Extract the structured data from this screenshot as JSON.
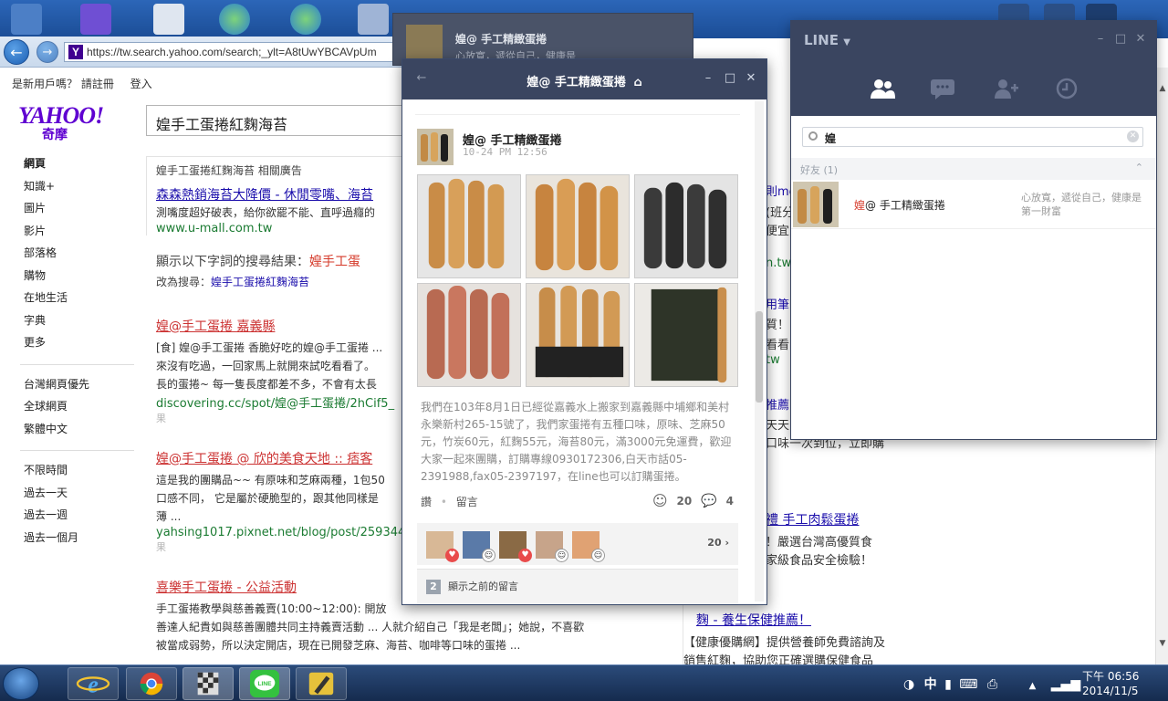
{
  "browser": {
    "url": "https://tw.search.yahoo.com/search;_ylt=A8tUwYBCAVpUm",
    "top_links": [
      "是新用戶嗎？ 請註冊",
      "登入"
    ],
    "logo_text": "YAHOO!",
    "logo_sub": "奇摩",
    "search_value": "媓手工蛋捲紅麴海苔"
  },
  "left_nav": {
    "group1": [
      "網頁",
      "知識+",
      "圖片",
      "影片",
      "部落格",
      "購物",
      "在地生活",
      "字典",
      "更多"
    ],
    "group2": [
      "台灣網頁優先",
      "全球網頁",
      "繁體中文"
    ],
    "group3": [
      "不限時間",
      "過去一天",
      "過去一週",
      "過去一個月"
    ]
  },
  "results": {
    "ad_header": "媓手工蛋捲紅麴海苔 相關廣告",
    "ad1_title": "森森熱銷海苔大降價 - 休閒零嘴、海苔",
    "ad1_text": "測嘴度超好破表，給你欲罷不能、直呼過癮的",
    "ad1_url": "www.u-mall.com.tw",
    "showing_label": "顯示以下字詞的搜尋結果：",
    "showing_term": "媓手工蛋",
    "instead_label": "改為搜尋：",
    "instead_term": "媓手工蛋捲紅麴海苔",
    "r1_title": "媓@手工蛋捲 嘉義縣",
    "r1_line1": "[食] 媓@手工蛋捲 香脆好吃的媓@手工蛋捲 ...",
    "r1_line2": "來沒有吃過，一回家馬上就開來試吃看看了。",
    "r1_line3": "長的蛋捲~ 每一隻長度都差不多，不會有太長",
    "r1_url": "discovering.cc/spot/媓@手工蛋捲/2hCif5_",
    "r1_small": "果",
    "r2_title": "媓@手工蛋捲 @ 欣的美食天地 :: 痞客",
    "r2_line1": "這是我的團購品~~ 有原味和芝麻兩種，1包50",
    "r2_line2": "口感不同， 它是屬於硬脆型的，跟其他同樣是",
    "r2_line3": "薄 ...",
    "r2_url": "yahsing1017.pixnet.net/blog/post/2593441",
    "r2_small": "果",
    "r3_title": "喜樂手工蛋捲 - 公益活動",
    "r3_line1": "手工蛋捲教學與慈善義賣(10:00~12:00): 開放",
    "r3_line2": "善達人紀貴如與慈善團體共同主持義賣活動 ... 人就介紹自己「我是老闆」；她說，不喜歡",
    "r3_line3": "被當成弱勢，所以決定開店，現在已開發芝麻、海苔、咖啡等口味的蛋捲 ..."
  },
  "right_col": {
    "f1": "則mc",
    "f2": "(班分",
    "f3": "便宜",
    "f4": "n.tw",
    "f5": "用筆",
    "f6": "質！",
    "f7": "看看",
    "f8": "tw",
    "f9": "推薦",
    "f10": "天天",
    "f11": "口味一次到位，立即購",
    "ad_title": "禮 手工肉鬆蛋捲",
    "ad_l1": "！嚴選台灣高優質食",
    "ad_l2": "家級食品安全檢驗！",
    "ad2_title": "麴 - 養生保健推薦！",
    "ad2_l1": "【健康優購網】提供營養師免費諮詢及",
    "ad2_l2": "銷售紅麴，協助您正確選購保健食品"
  },
  "ghost": {
    "title": "媓@ 手工精緻蛋捲",
    "sub": "心放寬，遞從自己，健康是"
  },
  "chat": {
    "title": "媓@ 手工精緻蛋捲",
    "author": "媓@ 手工精緻蛋捲",
    "time": "10-24 PM 12:56",
    "text": "我們在103年8月1日已經從嘉義水上搬家到嘉義縣中埔鄉和美村永樂新村265-15號了，我們家蛋捲有五種口味，原味、芝麻50元，竹炭60元，紅麴55元，海苔80元，滿3000元免運費，歡迎大家一起來團購，訂購專線0930172306,白天市話05-2391988,fax05-2397197，在line也可以訂購蛋捲。",
    "like_label": "讚",
    "comment_label": "留言",
    "like_count": "20",
    "comment_count": "4",
    "likers_count": "20",
    "prev_badge": "2",
    "prev_label": "顯示之前的留言"
  },
  "line_main": {
    "brand": "LINE",
    "search_value": "媓",
    "friends_label": "好友 (1)",
    "friend_name_hl": "媓",
    "friend_name_rest": "@ 手工精緻蛋捲",
    "friend_status": "心放寬，遞從自己，健康是第一財富"
  },
  "taskbar": {
    "tray_ime": "中",
    "time": "下午 06:56",
    "date": "2014/11/5"
  },
  "colors": {
    "line_header": "#3a4560",
    "taskbar": "#1c3760",
    "link": "#1a0dab",
    "highlight": "#d53a2a",
    "url_green": "#1b7b32"
  }
}
